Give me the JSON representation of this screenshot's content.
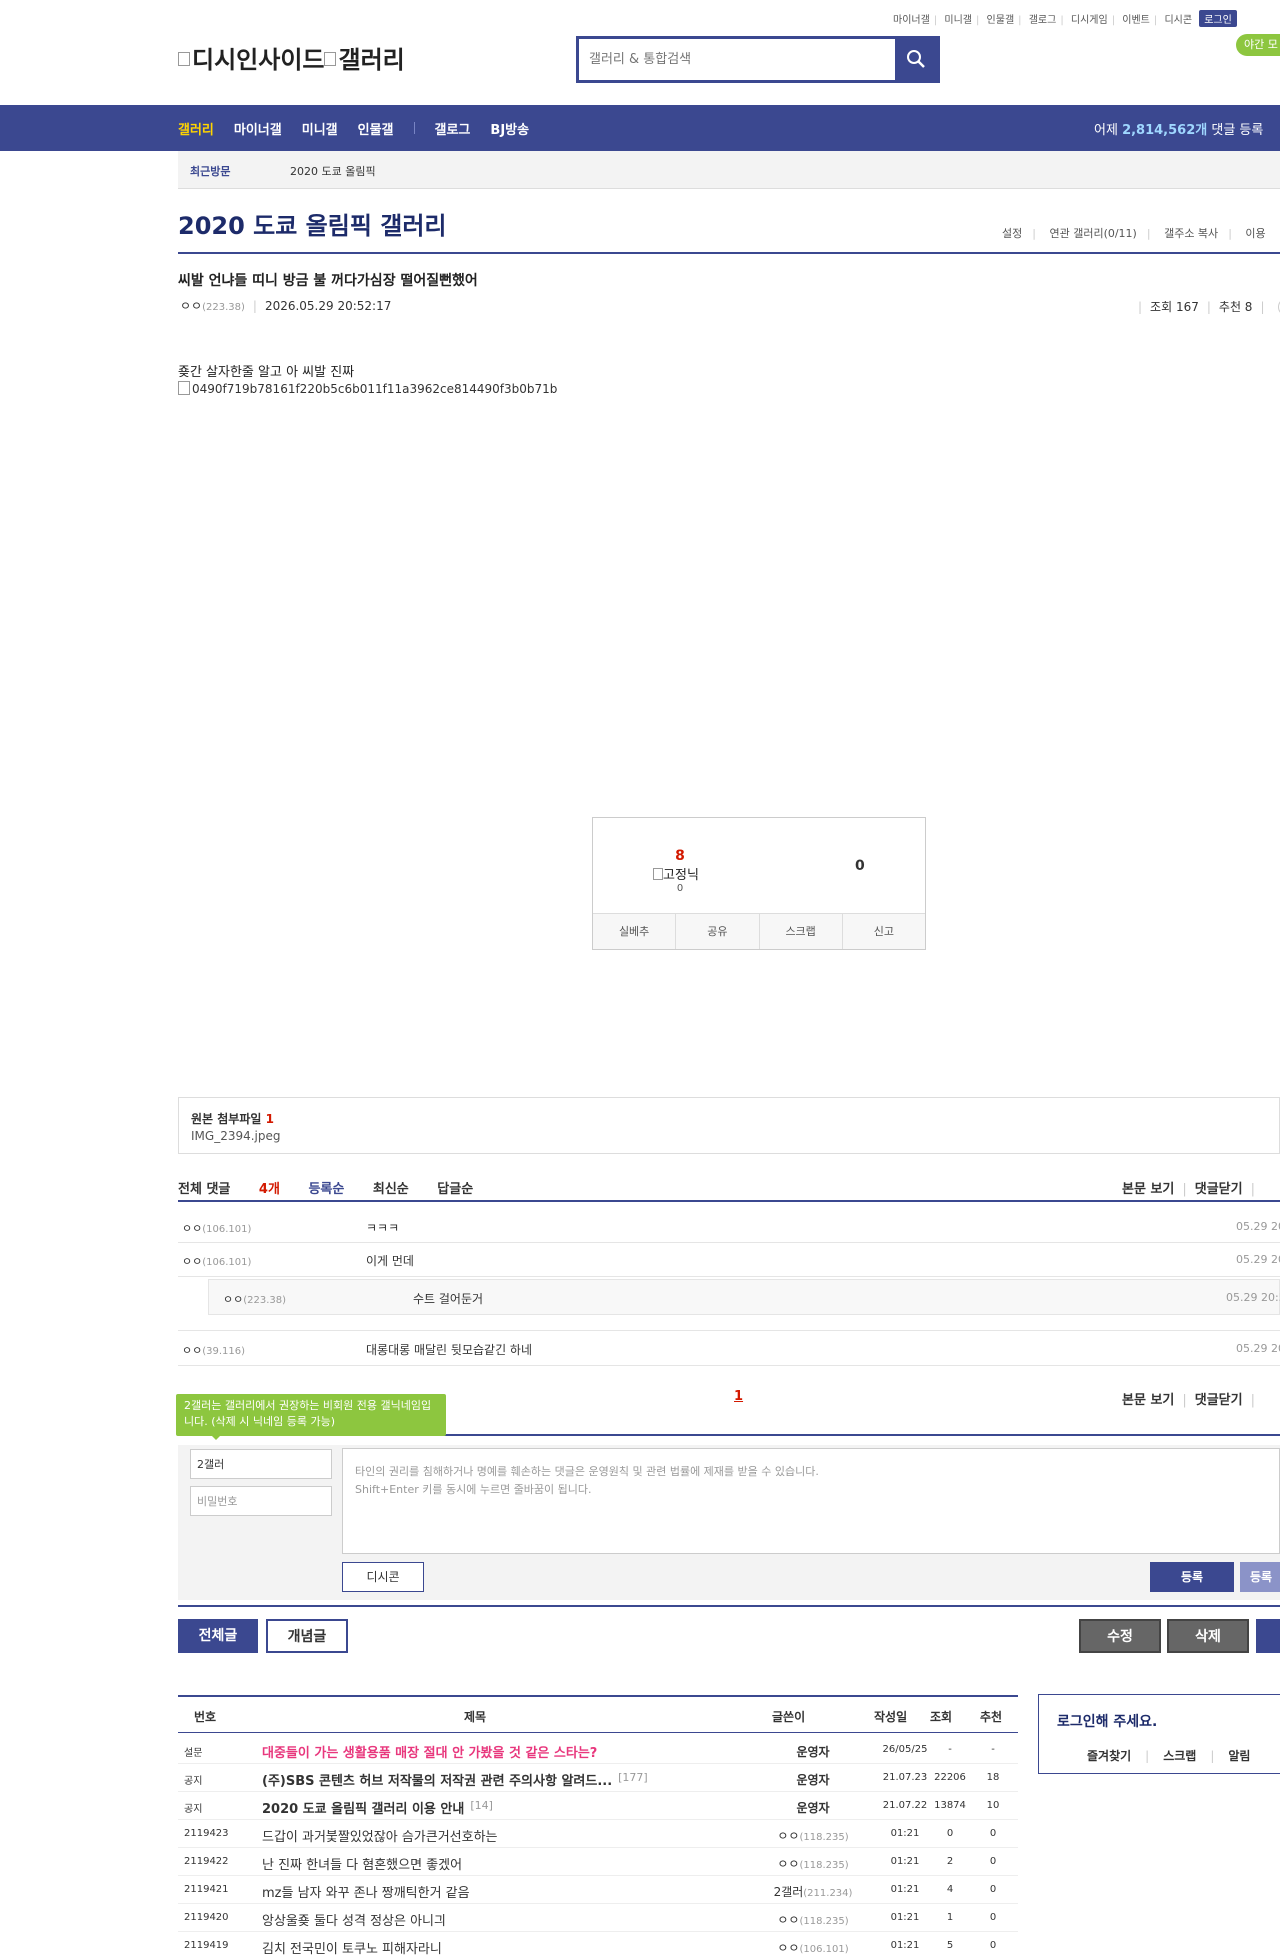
{
  "top_links": [
    "마이너갤",
    "미니갤",
    "인물갤",
    "갤로그",
    "디시게임",
    "이벤트",
    "디시콘"
  ],
  "login_label": "로그인",
  "night_mode": "야간 모",
  "logo_text": "디시인사이드",
  "logo_gallery": "갤러리",
  "search_placeholder": "갤러리 & 통합검색",
  "nav": {
    "items": [
      "갤러리",
      "마이너갤",
      "미니갤",
      "인물갤",
      "갤로그",
      "BJ방송"
    ],
    "stat_prefix": "어제",
    "stat_value": "2,814,562개",
    "stat_suffix": "댓글 등록"
  },
  "recent": {
    "label": "최근방문",
    "item": "2020 도쿄 올림픽"
  },
  "gallery_title": "2020 도쿄 올림픽 갤러리",
  "gallery_menu": [
    "설정",
    "연관 갤러리(0/11)",
    "갤주소 복사",
    "이용"
  ],
  "post": {
    "title": "씨발 언냐들 띠니 방금 불 꺼다가심장 떨어질뻔했어",
    "author": "ㅇㅇ",
    "author_ip": "(223.38)",
    "datetime": "2026.05.29 20:52:17",
    "views_label": "조회 167",
    "recommend_label": "추천 8",
    "body": "죶간 살자한줄 알고 아 씨발 진짜",
    "image_alt": "0490f719b78161f220b5c6b011f11a3962ce814490f3b0b71b"
  },
  "vote": {
    "up_count": "8",
    "fixed_label": "고정닉",
    "fixed_count": "0",
    "down_count": "0",
    "buttons": [
      "실베추",
      "공유",
      "스크랩",
      "신고"
    ]
  },
  "attachment": {
    "label": "원본 첨부파일",
    "count": "1",
    "file": "IMG_2394.jpeg"
  },
  "comments_header": {
    "total_label": "전체 댓글",
    "total_count": "4개",
    "sorts": [
      "등록순",
      "최신순",
      "답글순"
    ],
    "view_body": "본문 보기",
    "close": "댓글닫기"
  },
  "comments": [
    {
      "nick": "ㅇㅇ",
      "ip": "(106.101)",
      "text": "ㅋㅋㅋ",
      "date": "05.29 20"
    },
    {
      "nick": "ㅇㅇ",
      "ip": "(106.101)",
      "text": "이게 먼데",
      "date": "05.29 20"
    },
    {
      "nick": "ㅇㅇ",
      "ip": "(223.38)",
      "text": "수트 걸어둔거",
      "date": "05.29 20:5"
    },
    {
      "nick": "ㅇㅇ",
      "ip": "(39.116)",
      "text": "대롱대롱 매달린 뒷모습같긴 하네",
      "date": "05.29 20"
    }
  ],
  "comment_page": "1",
  "comment_form": {
    "tooltip": "2갤러는 갤러리에서 권장하는 비회원 전용 갤닉네임입니다. (삭제 시 닉네임 등록 가능)",
    "nick_value": "2갤러",
    "password_placeholder": "비밀번호",
    "textarea_line1": "타인의 권리를 침해하거나 명예를 훼손하는 댓글은 운영원칙 및 관련 법률에 제재를 받을 수 있습니다.",
    "textarea_line2": "Shift+Enter 키를 동시에 누르면 줄바꿈이 됩니다.",
    "dccon": "디시콘",
    "submit": "등록",
    "submit2": "등록"
  },
  "post_buttons": {
    "all": "전체글",
    "concept": "개념글",
    "edit": "수정",
    "delete": "삭제"
  },
  "list": {
    "headers": [
      "번호",
      "제목",
      "글쓴이",
      "작성일",
      "조회",
      "추천"
    ],
    "rows": [
      {
        "num": "설문",
        "title": "대중들이 가는 생활용품 매장 절대 안 가봤을 것 같은 스타는?",
        "count": "",
        "writer": "운영자",
        "ip": "",
        "date": "26/05/25",
        "views": "-",
        "rec": "-",
        "type": "survey"
      },
      {
        "num": "공지",
        "title": "(주)SBS 콘텐츠 허브 저작물의 저작권 관련 주의사항 알려드...",
        "count": "[177]",
        "writer": "운영자",
        "ip": "",
        "date": "21.07.23",
        "views": "22206",
        "rec": "18",
        "type": "notice"
      },
      {
        "num": "공지",
        "title": "2020 도쿄 올림픽 갤러리 이용 안내",
        "count": "[14]",
        "writer": "운영자",
        "ip": "",
        "date": "21.07.22",
        "views": "13874",
        "rec": "10",
        "type": "notice"
      },
      {
        "num": "2119423",
        "title": "드갑이 과거붗짤있었잖아 슴가큰거선호하는",
        "count": "",
        "writer": "ㅇㅇ",
        "ip": "(118.235)",
        "date": "01:21",
        "views": "0",
        "rec": "0",
        "type": "normal"
      },
      {
        "num": "2119422",
        "title": "난 진짜 한녀들 다 혐혼했으면 좋겠어",
        "count": "",
        "writer": "ㅇㅇ",
        "ip": "(118.235)",
        "date": "01:21",
        "views": "2",
        "rec": "0",
        "type": "normal"
      },
      {
        "num": "2119421",
        "title": "mz들 남자 와꾸 존나 짱깨틱한거 같음",
        "count": "",
        "writer": "2갤러",
        "ip": "(211.234)",
        "date": "01:21",
        "views": "4",
        "rec": "0",
        "type": "normal"
      },
      {
        "num": "2119420",
        "title": "앙상울죶 둘다 성격 정상은 아니긔",
        "count": "",
        "writer": "ㅇㅇ",
        "ip": "(118.235)",
        "date": "01:21",
        "views": "1",
        "rec": "0",
        "type": "normal"
      },
      {
        "num": "2119419",
        "title": "김치 전국민이 토쿠노 피해자라니",
        "count": "",
        "writer": "ㅇㅇ",
        "ip": "(106.101)",
        "date": "01:21",
        "views": "5",
        "rec": "0",
        "type": "normal"
      }
    ]
  },
  "login_box": {
    "title": "로그인해 주세요.",
    "menu": [
      "즐겨찾기",
      "스크랩",
      "알림"
    ]
  },
  "colors": {
    "brand": "#3b4890",
    "accent_red": "#d31900",
    "survey_pink": "#e8377d",
    "nav_active": "#ffd400",
    "green": "#8dc63f"
  }
}
